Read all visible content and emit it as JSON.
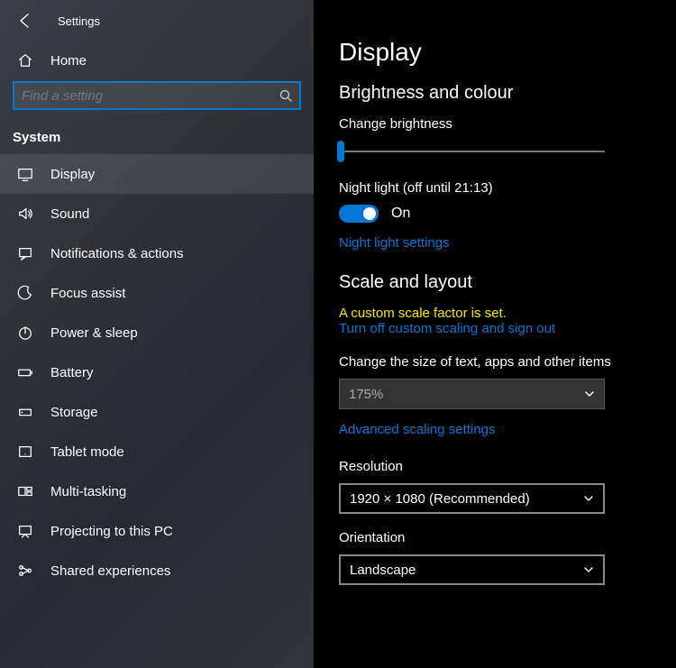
{
  "window": {
    "title": "Settings"
  },
  "sidebar": {
    "home": "Home",
    "search_placeholder": "Find a setting",
    "category": "System",
    "items": [
      {
        "label": "Display"
      },
      {
        "label": "Sound"
      },
      {
        "label": "Notifications & actions"
      },
      {
        "label": "Focus assist"
      },
      {
        "label": "Power & sleep"
      },
      {
        "label": "Battery"
      },
      {
        "label": "Storage"
      },
      {
        "label": "Tablet mode"
      },
      {
        "label": "Multi-tasking"
      },
      {
        "label": "Projecting to this PC"
      },
      {
        "label": "Shared experiences"
      }
    ]
  },
  "main": {
    "title": "Display",
    "section_brightness": "Brightness and colour",
    "brightness_label": "Change brightness",
    "night_light_label": "Night light (off until 21:13)",
    "toggle_on": "On",
    "night_light_settings": "Night light settings",
    "section_scale": "Scale and layout",
    "custom_scale_warning": "A custom scale factor is set.",
    "turn_off_scaling": "Turn off custom scaling and sign out",
    "text_size_label": "Change the size of text, apps and other items",
    "text_size_value": "175%",
    "advanced_scaling": "Advanced scaling settings",
    "resolution_label": "Resolution",
    "resolution_value": "1920 × 1080 (Recommended)",
    "orientation_label": "Orientation",
    "orientation_value": "Landscape"
  }
}
